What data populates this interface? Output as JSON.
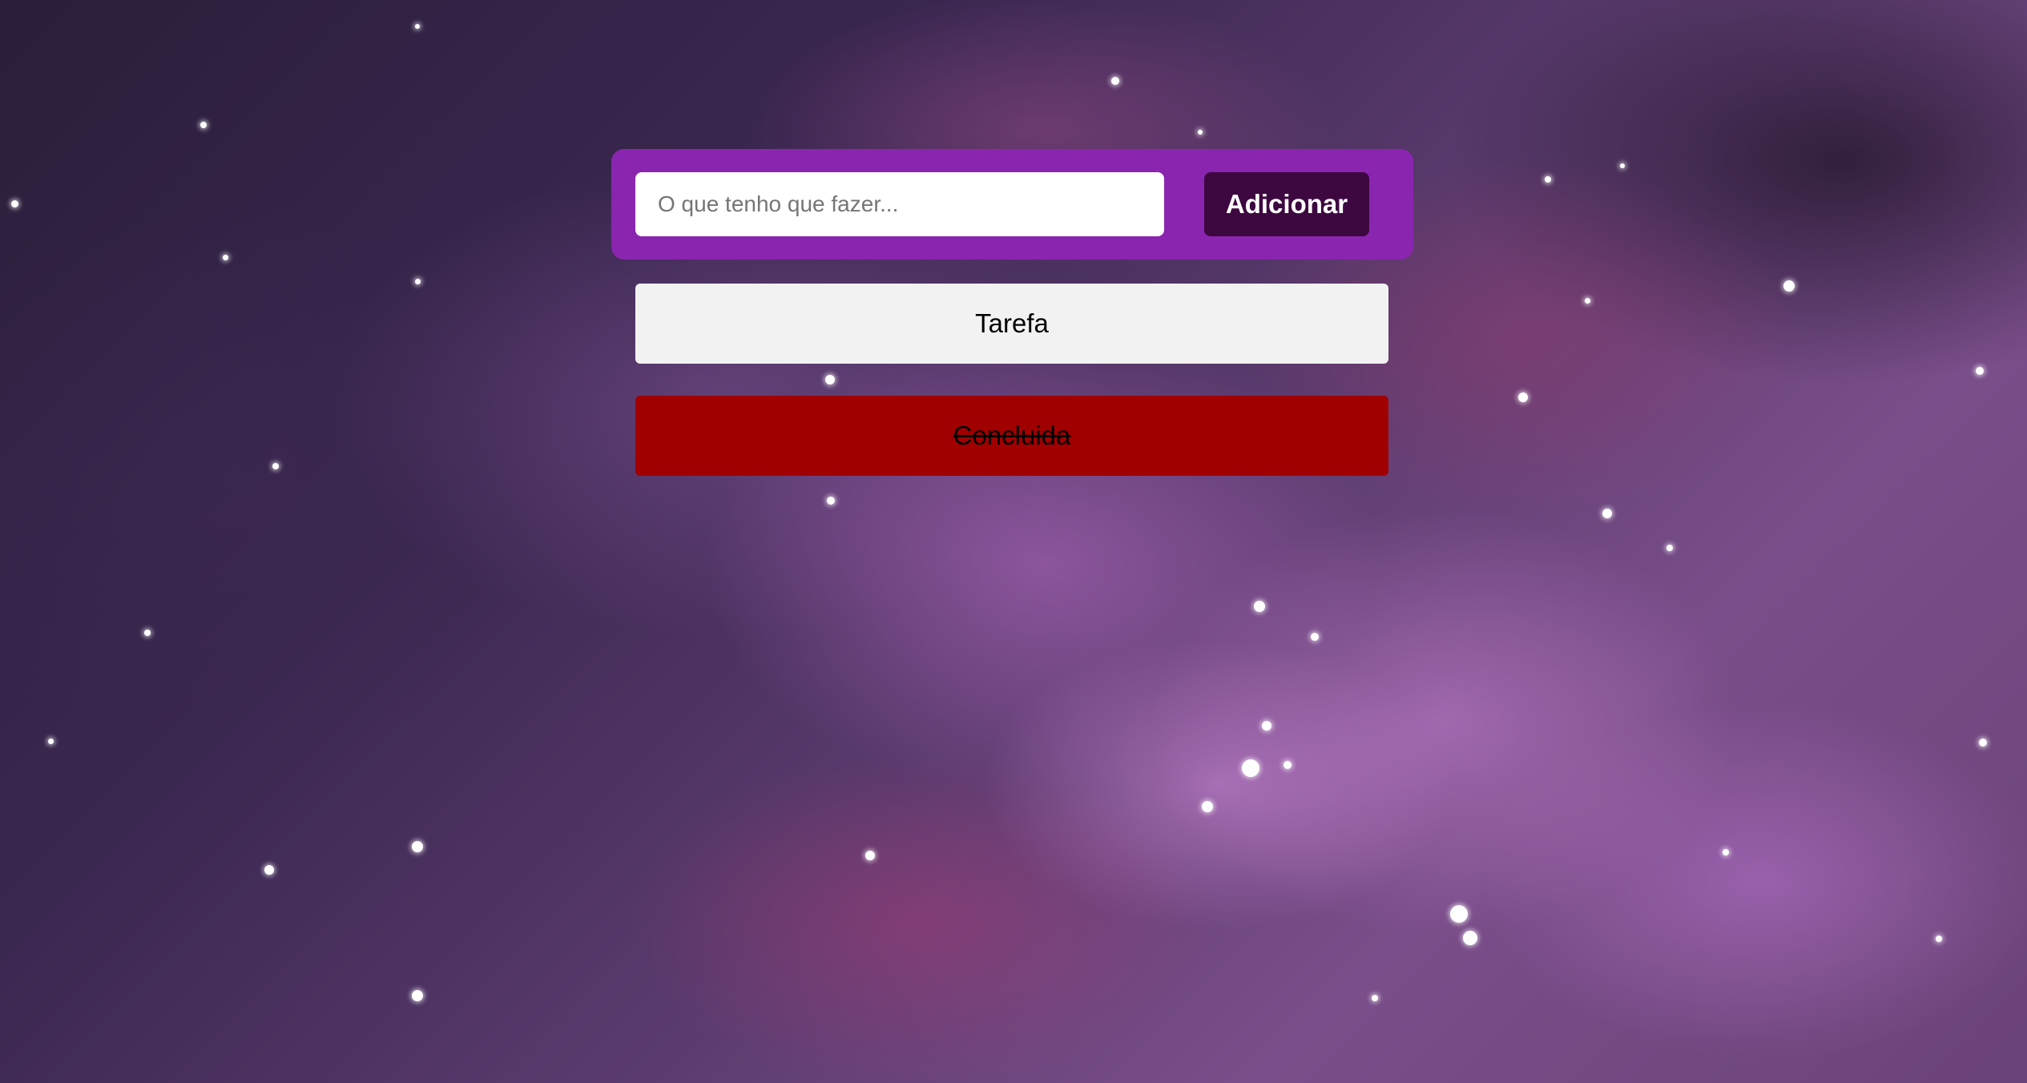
{
  "form": {
    "input_placeholder": "O que tenho que fazer...",
    "input_value": "",
    "add_button_label": "Adicionar"
  },
  "tasks": [
    {
      "label": "Tarefa",
      "completed": false
    },
    {
      "label": "Concluida",
      "completed": true
    }
  ],
  "colors": {
    "form_background": "#8a25b0",
    "add_button_background": "#3d0840",
    "pending_task_background": "#f2f2f2",
    "completed_task_background": "#a00000"
  }
}
